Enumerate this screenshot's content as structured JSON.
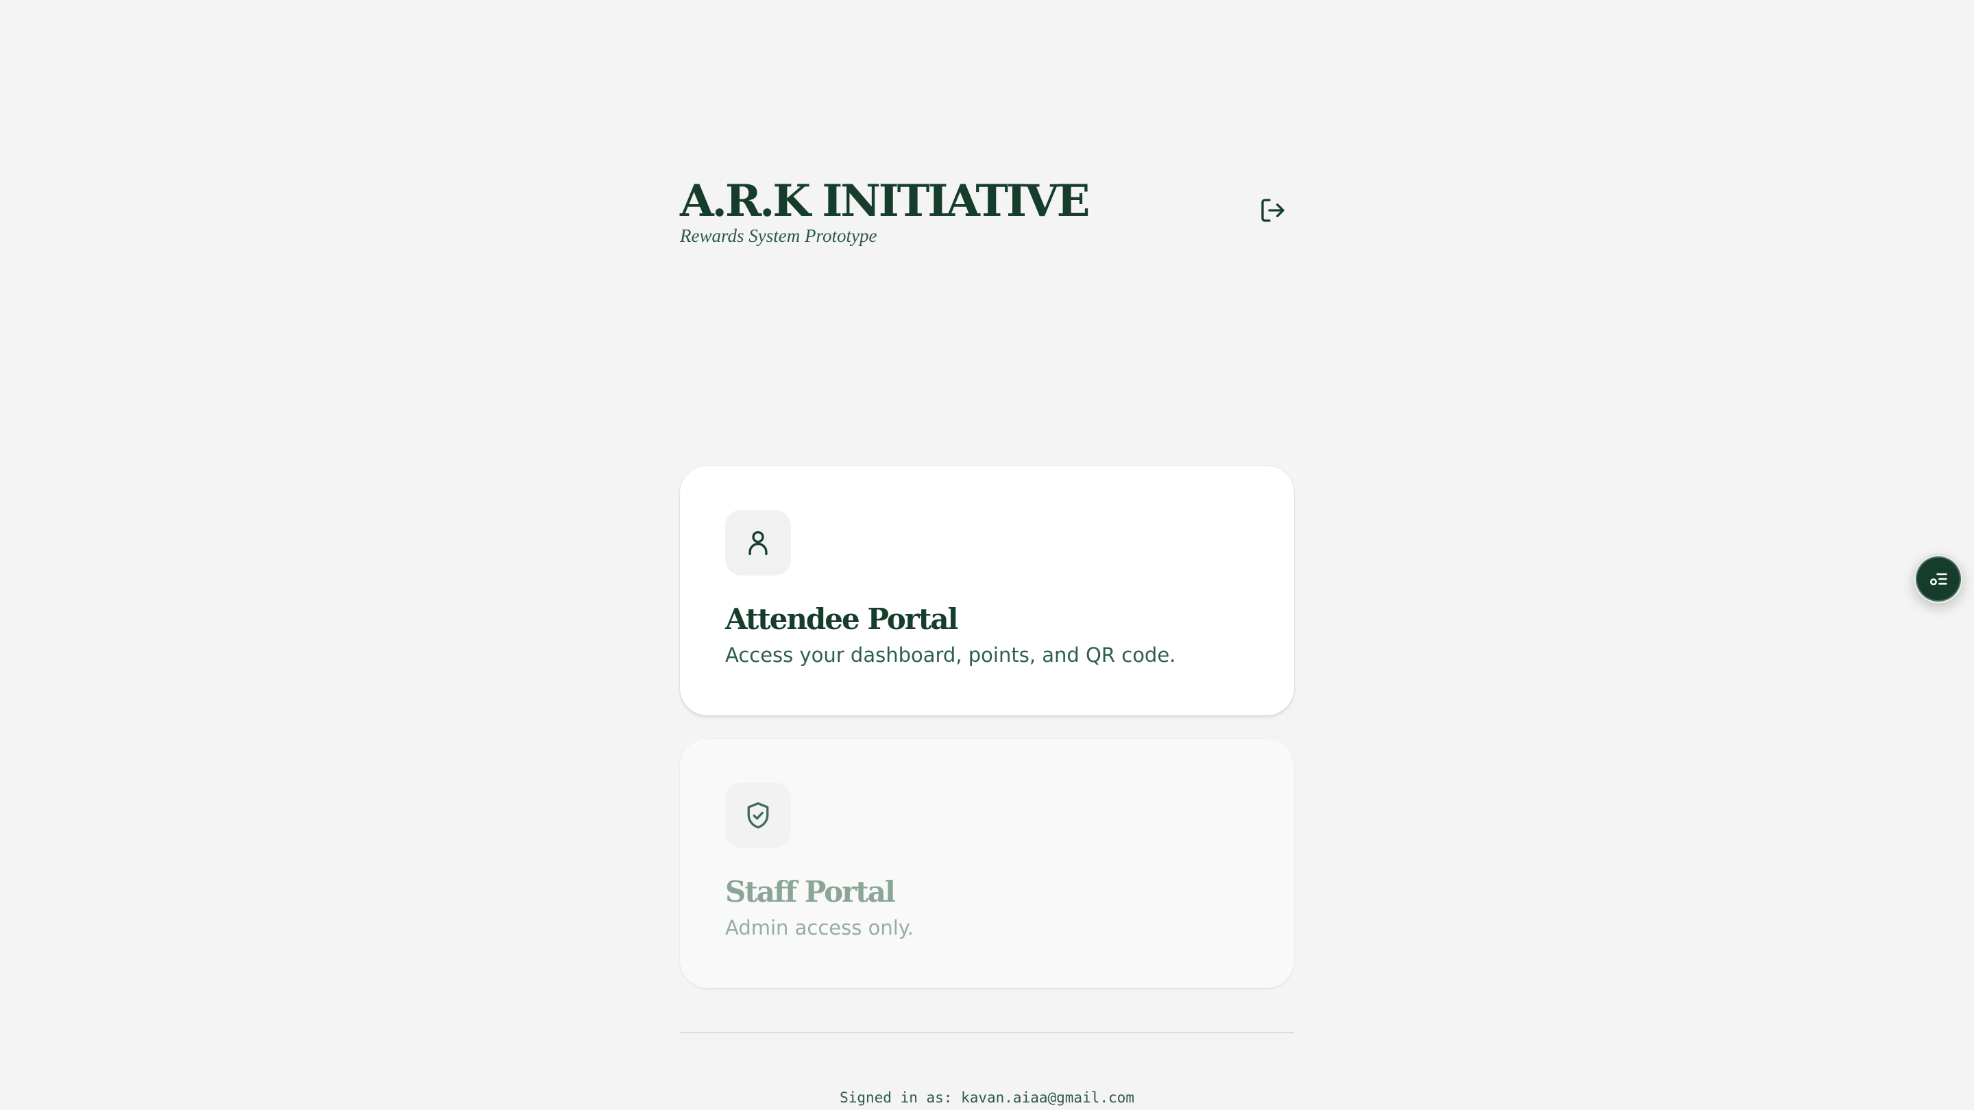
{
  "header": {
    "title": "A.R.K INITIATIVE",
    "subtitle": "Rewards System Prototype",
    "logout_icon": "logout-icon"
  },
  "cards": [
    {
      "title": "Attendee Portal",
      "description": "Access your dashboard, points, and QR code.",
      "icon": "user-icon",
      "enabled": true
    },
    {
      "title": "Staff Portal",
      "description": "Admin access only.",
      "icon": "shield-check-icon",
      "enabled": false
    }
  ],
  "footer": {
    "signed_in": "Signed in as: kavan.aiaa@gmail.com"
  },
  "fab": {
    "icon": "list-settings-icon"
  },
  "colors": {
    "background": "#f4f4f4",
    "brand": "#163d2c",
    "text_secondary": "#2e6048",
    "disabled_text": "#98ac9f"
  }
}
